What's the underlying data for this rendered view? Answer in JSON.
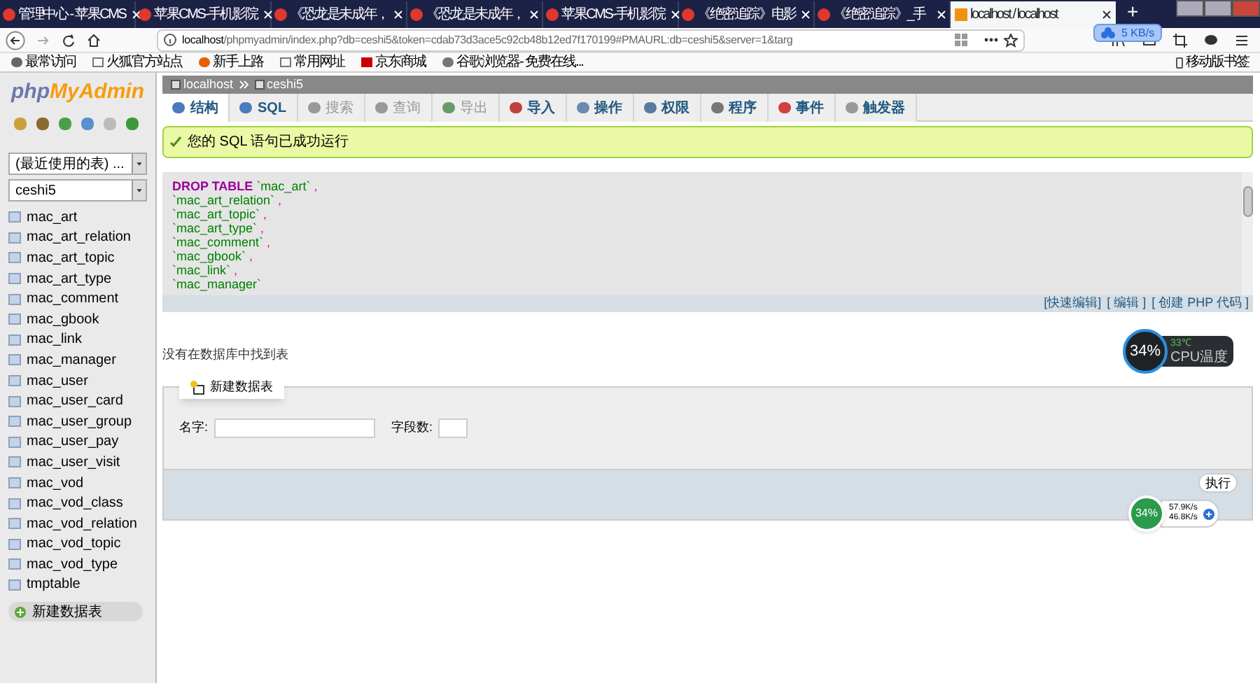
{
  "browser": {
    "tabs": [
      {
        "title": "管理中心 - 苹果CMS",
        "selected": false
      },
      {
        "title": "苹果CMS-手机影院",
        "selected": false
      },
      {
        "title": "《恐龙是未成年，",
        "selected": false
      },
      {
        "title": "《恐龙是未成年，",
        "selected": false
      },
      {
        "title": "苹果CMS-手机影院",
        "selected": false
      },
      {
        "title": "《绝密追踪》电影",
        "selected": false
      },
      {
        "title": "《绝密追踪》_手",
        "selected": false
      },
      {
        "title": "localhost / localhost",
        "selected": true
      }
    ],
    "new_tab": "+",
    "url_host": "localhost",
    "url_rest": "/phpmyadmin/index.php?db=ceshi5&token=cdab73d3ace5c92cb48b12ed7f170199#PMAURL:db=ceshi5&server=1&targ",
    "speed_badge": "5 KB/s",
    "bookmarks": [
      "最常访问",
      "火狐官方站点",
      "新手上路",
      "常用网址",
      "京东商城",
      "谷歌浏览器- 免费在线..."
    ],
    "mobile_bookmarks": "移动版书签"
  },
  "sidebar": {
    "logo_php": "php",
    "logo_myadmin": "MyAdmin",
    "recent_select": "(最近使用的表) ...",
    "db_select": "ceshi5",
    "tables": [
      "mac_art",
      "mac_art_relation",
      "mac_art_topic",
      "mac_art_type",
      "mac_comment",
      "mac_gbook",
      "mac_link",
      "mac_manager",
      "mac_user",
      "mac_user_card",
      "mac_user_group",
      "mac_user_pay",
      "mac_user_visit",
      "mac_vod",
      "mac_vod_class",
      "mac_vod_relation",
      "mac_vod_topic",
      "mac_vod_type",
      "tmptable"
    ],
    "new_table": "新建数据表"
  },
  "main": {
    "breadcrumb": [
      "localhost",
      "ceshi5"
    ],
    "tabs": [
      {
        "label": "结构",
        "selected": true,
        "disabled": false
      },
      {
        "label": "SQL",
        "selected": false,
        "disabled": false
      },
      {
        "label": "搜索",
        "selected": false,
        "disabled": true
      },
      {
        "label": "查询",
        "selected": false,
        "disabled": true
      },
      {
        "label": "导出",
        "selected": false,
        "disabled": true
      },
      {
        "label": "导入",
        "selected": false,
        "disabled": false
      },
      {
        "label": "操作",
        "selected": false,
        "disabled": false
      },
      {
        "label": "权限",
        "selected": false,
        "disabled": false
      },
      {
        "label": "程序",
        "selected": false,
        "disabled": false
      },
      {
        "label": "事件",
        "selected": false,
        "disabled": false
      },
      {
        "label": "触发器",
        "selected": false,
        "disabled": false
      }
    ],
    "success": "您的 SQL 语句已成功运行",
    "sql": {
      "keyword": "DROP TABLE",
      "tables": [
        {
          "name": "`mac_art`",
          "sep": ","
        },
        {
          "name": "`mac_art_relation`",
          "sep": ","
        },
        {
          "name": "`mac_art_topic`",
          "sep": ","
        },
        {
          "name": "`mac_art_type`",
          "sep": ","
        },
        {
          "name": "`mac_comment`",
          "sep": ","
        },
        {
          "name": "`mac_gbook`",
          "sep": ","
        },
        {
          "name": "`mac_link`",
          "sep": ","
        },
        {
          "name": "`mac_manager`"
        }
      ]
    },
    "sql_links": [
      "[快速编辑]",
      "[ 编辑 ]",
      "[ 创建 PHP 代码 ]"
    ],
    "no_tables": "没有在数据库中找到表",
    "create": {
      "legend": "新建数据表",
      "name_label": "名字:",
      "fields_label": "字段数:",
      "submit": "执行"
    }
  },
  "widgets": {
    "cpu": {
      "percent": "34%",
      "temp": "33℃",
      "label": "CPU温度"
    },
    "net": {
      "percent": "34%",
      "up": "57.9K/s",
      "down": "46.8K/s"
    }
  }
}
